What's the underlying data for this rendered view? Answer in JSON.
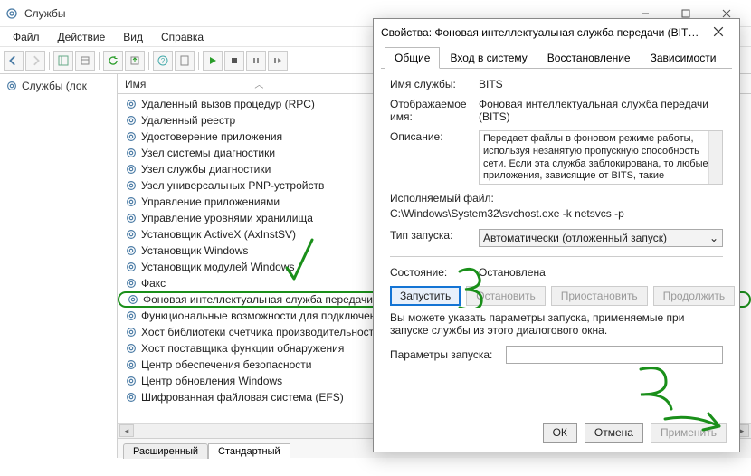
{
  "window": {
    "title": "Службы",
    "menu": [
      "Файл",
      "Действие",
      "Вид",
      "Справка"
    ]
  },
  "left_panel": {
    "root": "Службы (лок"
  },
  "list_header": "Имя",
  "services": [
    "Удаленный вызов процедур (RPC)",
    "Удаленный реестр",
    "Удостоверение приложения",
    "Узел системы диагностики",
    "Узел службы диагностики",
    "Узел универсальных PNP-устройств",
    "Управление приложениями",
    "Управление уровнями хранилища",
    "Установщик ActiveX (AxInstSV)",
    "Установщик Windows",
    "Установщик модулей Windows",
    "Факс",
    "Фоновая интеллектуальная служба передачи (BITS)",
    "Функциональные возможности для подключенны…",
    "Хост библиотеки счетчика производительности",
    "Хост поставщика функции обнаружения",
    "Центр обеспечения безопасности",
    "Центр обновления Windows",
    "Шифрованная файловая система (EFS)"
  ],
  "selected_index": 12,
  "tabs": {
    "extended": "Расширенный",
    "standard": "Стандартный"
  },
  "dialog": {
    "title": "Свойства: Фоновая интеллектуальная служба передачи (BITS) (…",
    "tabs": {
      "general": "Общие",
      "logon": "Вход в систему",
      "recovery": "Восстановление",
      "deps": "Зависимости"
    },
    "labels": {
      "service_name": "Имя службы:",
      "display_name": "Отображаемое имя:",
      "description": "Описание:",
      "exe_path": "Исполняемый файл:",
      "startup_type": "Тип запуска:",
      "status": "Состояние:",
      "params_note": "Вы можете указать параметры запуска, применяемые при запуске службы из этого диалогового окна.",
      "startup_params": "Параметры запуска:"
    },
    "values": {
      "service_name": "BITS",
      "display_name": "Фоновая интеллектуальная служба передачи (BITS)",
      "description": "Передает файлы в фоновом режиме работы, используя незанятую пропускную способность сети. Если эта служба заблокирована, то любые приложения, зависящие от BITS, такие",
      "exe_path": "C:\\Windows\\System32\\svchost.exe -k netsvcs -p",
      "startup_type": "Автоматически (отложенный запуск)",
      "status": "Остановлена"
    },
    "buttons": {
      "start": "Запустить",
      "stop": "Остановить",
      "pause": "Приостановить",
      "resume": "Продолжить",
      "ok": "ОК",
      "cancel": "Отмена",
      "apply": "Применить"
    }
  }
}
